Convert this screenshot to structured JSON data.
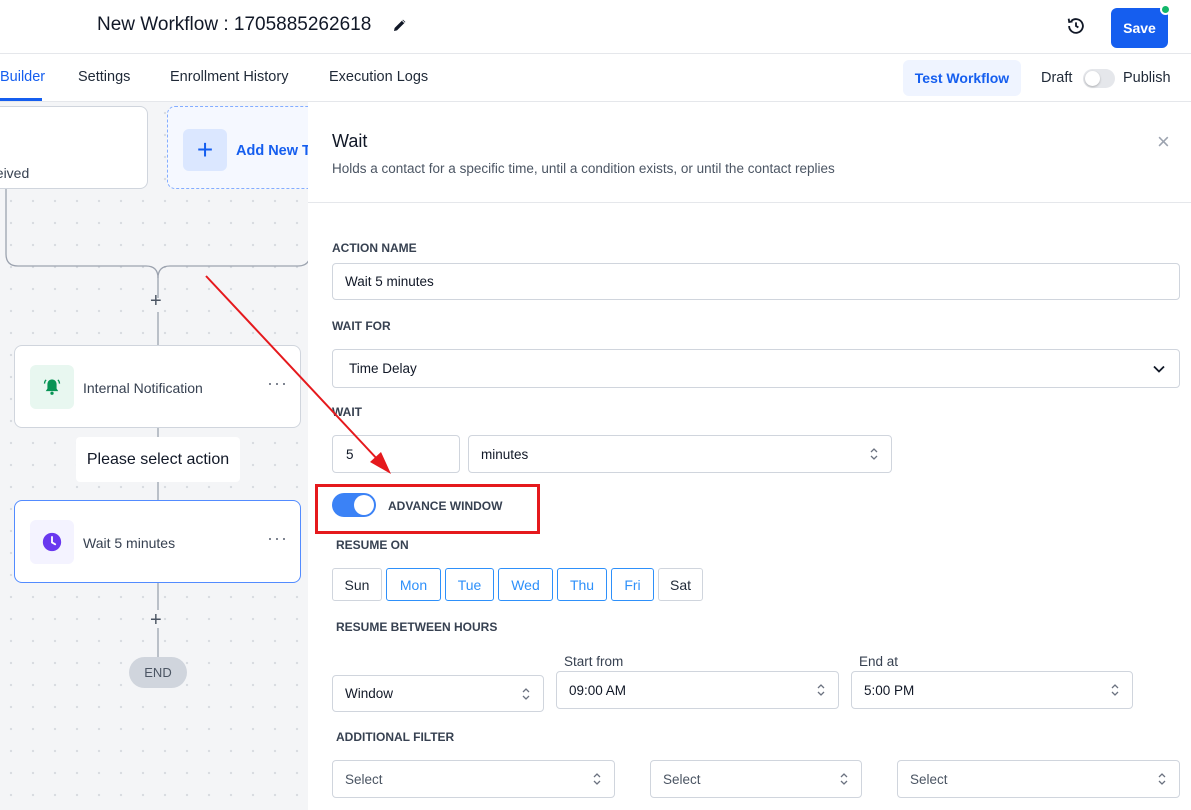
{
  "header": {
    "workflow_title": "New Workflow : 1705885262618",
    "save_label": "Save"
  },
  "tabs": {
    "builder": "Builder",
    "settings": "Settings",
    "enrollment_history": "Enrollment History",
    "execution_logs": "Execution Logs",
    "test_workflow": "Test Workflow",
    "draft": "Draft",
    "publish": "Publish"
  },
  "canvas": {
    "trigger_label": "eceived",
    "add_trigger_label": "Add New T",
    "notification_label": "Internal Notification",
    "select_action_label": "Please select action",
    "wait_label": "Wait 5 minutes",
    "end_label": "END",
    "dots": "···"
  },
  "panel": {
    "title": "Wait",
    "description": "Holds a contact for a specific time, until a condition exists, or until the contact replies",
    "action_name_label": "ACTION NAME",
    "action_name_value": "Wait 5 minutes",
    "wait_for_label": "WAIT FOR",
    "wait_for_value": "Time Delay",
    "wait_label": "WAIT",
    "wait_amount": "5",
    "wait_unit": "minutes",
    "advance_window_label": "ADVANCE WINDOW",
    "resume_on_label": "RESUME ON",
    "days": [
      {
        "label": "Sun",
        "selected": false
      },
      {
        "label": "Mon",
        "selected": true
      },
      {
        "label": "Tue",
        "selected": true
      },
      {
        "label": "Wed",
        "selected": true
      },
      {
        "label": "Thu",
        "selected": true
      },
      {
        "label": "Fri",
        "selected": true
      },
      {
        "label": "Sat",
        "selected": false
      }
    ],
    "resume_hours_label": "RESUME BETWEEN HOURS",
    "window_value": "Window",
    "start_from_label": "Start from",
    "start_from_value": "09:00 AM",
    "end_at_label": "End at",
    "end_at_value": "5:00 PM",
    "additional_filter_label": "ADDITIONAL FILTER",
    "filter_placeholder": "Select",
    "close_icon": "×"
  },
  "colors": {
    "primary": "#155eef",
    "toggle_on": "#3b82f6",
    "day_selected": "#2e90fa",
    "annotation": "#e5191d"
  }
}
